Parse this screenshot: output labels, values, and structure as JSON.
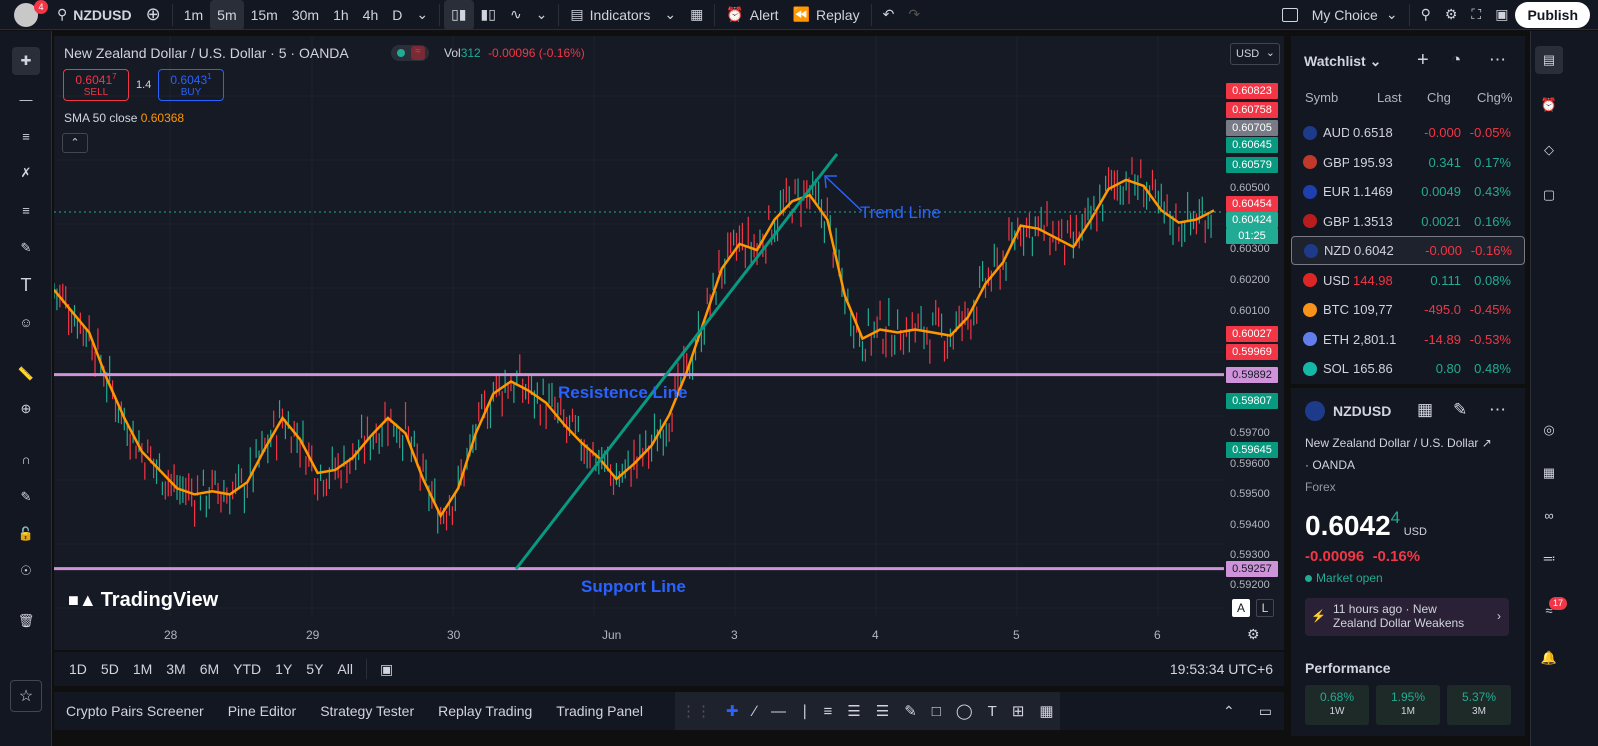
{
  "topbar": {
    "notif": "4",
    "symbol": "NZDUSD",
    "intervals": [
      "1m",
      "5m",
      "15m",
      "30m",
      "1h",
      "4h",
      "D"
    ],
    "indicators": "Indicators",
    "alert": "Alert",
    "replay": "Replay",
    "layout": "My Choice",
    "publish": "Publish"
  },
  "chart": {
    "title": "New Zealand Dollar / U.S. Dollar · 5 · OANDA",
    "vol_label": "Vol",
    "vol_value": "312",
    "change": "-0.00096 (-0.16%)",
    "sell_price": "0.6041",
    "sell_sup": "7",
    "sell_label": "SELL",
    "spread": "1.4",
    "buy_price": "0.6043",
    "buy_sup": "1",
    "buy_label": "BUY",
    "sma_label": "SMA 50 close",
    "sma_value": "0.60368",
    "currency": "USD",
    "annotations": {
      "trend": "Trend Line",
      "resistance": "Resistence Line",
      "support": "Support Line"
    },
    "brand": "TradingView",
    "countdown": "01:25",
    "auto": "A",
    "log": "L"
  },
  "chart_data": {
    "type": "line",
    "instrument": "NZDUSD",
    "y_ticks": [
      "0.60500",
      "0.60300",
      "0.60200",
      "0.60100",
      "0.59700",
      "0.59600",
      "0.59500",
      "0.59400",
      "0.59300",
      "0.59200"
    ],
    "x_ticks": [
      "28",
      "29",
      "30",
      "Jun",
      "3",
      "4",
      "5",
      "6"
    ],
    "price_labels": [
      {
        "v": "0.60823",
        "c": "#f23645"
      },
      {
        "v": "0.60758",
        "c": "#f23645"
      },
      {
        "v": "0.60705",
        "c": "#787b86"
      },
      {
        "v": "0.60645",
        "c": "#089981"
      },
      {
        "v": "0.60579",
        "c": "#089981"
      },
      {
        "v": "0.60454",
        "c": "#f23645"
      },
      {
        "v": "0.60424",
        "c": "#22ab94"
      },
      {
        "v": "0.60027",
        "c": "#f23645"
      },
      {
        "v": "0.59969",
        "c": "#f23645"
      },
      {
        "v": "0.59892",
        "c": "#ce93d8"
      },
      {
        "v": "0.59807",
        "c": "#089981"
      },
      {
        "v": "0.59645",
        "c": "#089981"
      },
      {
        "v": "0.59257",
        "c": "#ce93d8"
      }
    ],
    "resistance": 0.59892,
    "support": 0.59257,
    "sma": [
      0.6017,
      0.601,
      0.6003,
      0.5988,
      0.5975,
      0.5964,
      0.5958,
      0.5952,
      0.595,
      0.5951,
      0.595,
      0.5954,
      0.5965,
      0.5975,
      0.5968,
      0.5957,
      0.5958,
      0.5962,
      0.5969,
      0.5975,
      0.597,
      0.5955,
      0.5943,
      0.5952,
      0.597,
      0.5983,
      0.5987,
      0.5984,
      0.598,
      0.5973,
      0.5967,
      0.5962,
      0.5955,
      0.596,
      0.5966,
      0.5976,
      0.599,
      0.6007,
      0.6024,
      0.6032,
      0.603,
      0.604,
      0.6046,
      0.6048,
      0.604,
      0.6015,
      0.6001,
      0.6004,
      0.6003,
      0.6004,
      0.6003,
      0.6002,
      0.6008,
      0.6019,
      0.6026,
      0.6038,
      0.6037,
      0.6034,
      0.6031,
      0.604,
      0.605,
      0.6053,
      0.6051,
      0.6043,
      0.6039,
      0.604,
      0.6043
    ]
  },
  "timeframes": [
    "1D",
    "5D",
    "1M",
    "3M",
    "6M",
    "YTD",
    "1Y",
    "5Y",
    "All"
  ],
  "clock": "19:53:34 UTC+6",
  "bottom": [
    "Crypto Pairs Screener",
    "Pine Editor",
    "Strategy Tester",
    "Replay Trading",
    "Trading Panel"
  ],
  "watchlist": {
    "title": "Watchlist",
    "cols": [
      "Symb",
      "Last",
      "Chg",
      "Chg%"
    ],
    "rows": [
      {
        "sym": "AUD",
        "last": "0.6518",
        "chg": "-0.000",
        "pct": "-0.05%",
        "up": false,
        "flag": "#1e3a8a"
      },
      {
        "sym": "GBP",
        "last": "195.93",
        "chg": "0.341",
        "pct": "0.17%",
        "up": true,
        "flag": "#c0392b"
      },
      {
        "sym": "EUR",
        "last": "1.1469",
        "chg": "0.0049",
        "pct": "0.43%",
        "up": true,
        "flag": "#1e40af"
      },
      {
        "sym": "GBP",
        "last": "1.3513",
        "chg": "0.0021",
        "pct": "0.16%",
        "up": true,
        "flag": "#b91c1c"
      },
      {
        "sym": "NZD",
        "last": "0.6042",
        "chg": "-0.000",
        "pct": "-0.16%",
        "up": false,
        "flag": "#1e3a8a"
      },
      {
        "sym": "USD",
        "last": "144.98",
        "chg": "0.111",
        "pct": "0.08%",
        "up": true,
        "flag": "#dc2626",
        "lastred": true
      },
      {
        "sym": "BTC",
        "last": "109,77",
        "chg": "-495.0",
        "pct": "-0.45%",
        "up": false,
        "flag": "#f7931a"
      },
      {
        "sym": "ETH",
        "last": "2,801.1",
        "chg": "-14.89",
        "pct": "-0.53%",
        "up": false,
        "flag": "#627eea"
      },
      {
        "sym": "SOL",
        "last": "165.86",
        "chg": "0.80",
        "pct": "0.48%",
        "up": true,
        "flag": "#14b8a6"
      }
    ]
  },
  "details": {
    "symbol": "NZDUSD",
    "name": "New Zealand Dollar / U.S. Dollar",
    "exchange": "· OANDA",
    "category": "Forex",
    "price": "0.6042",
    "price_sup": "4",
    "currency": "USD",
    "change": "-0.00096",
    "change_pct": "-0.16%",
    "status": "Market open",
    "news_time": "11 hours ago",
    "news_title": "New Zealand Dollar Weakens",
    "performance": "Performance",
    "perf": [
      {
        "v": "0.68%",
        "p": "1W"
      },
      {
        "v": "1.95%",
        "p": "1M"
      },
      {
        "v": "5.37%",
        "p": "3M"
      }
    ]
  },
  "rightbar": {
    "badge": "17"
  }
}
